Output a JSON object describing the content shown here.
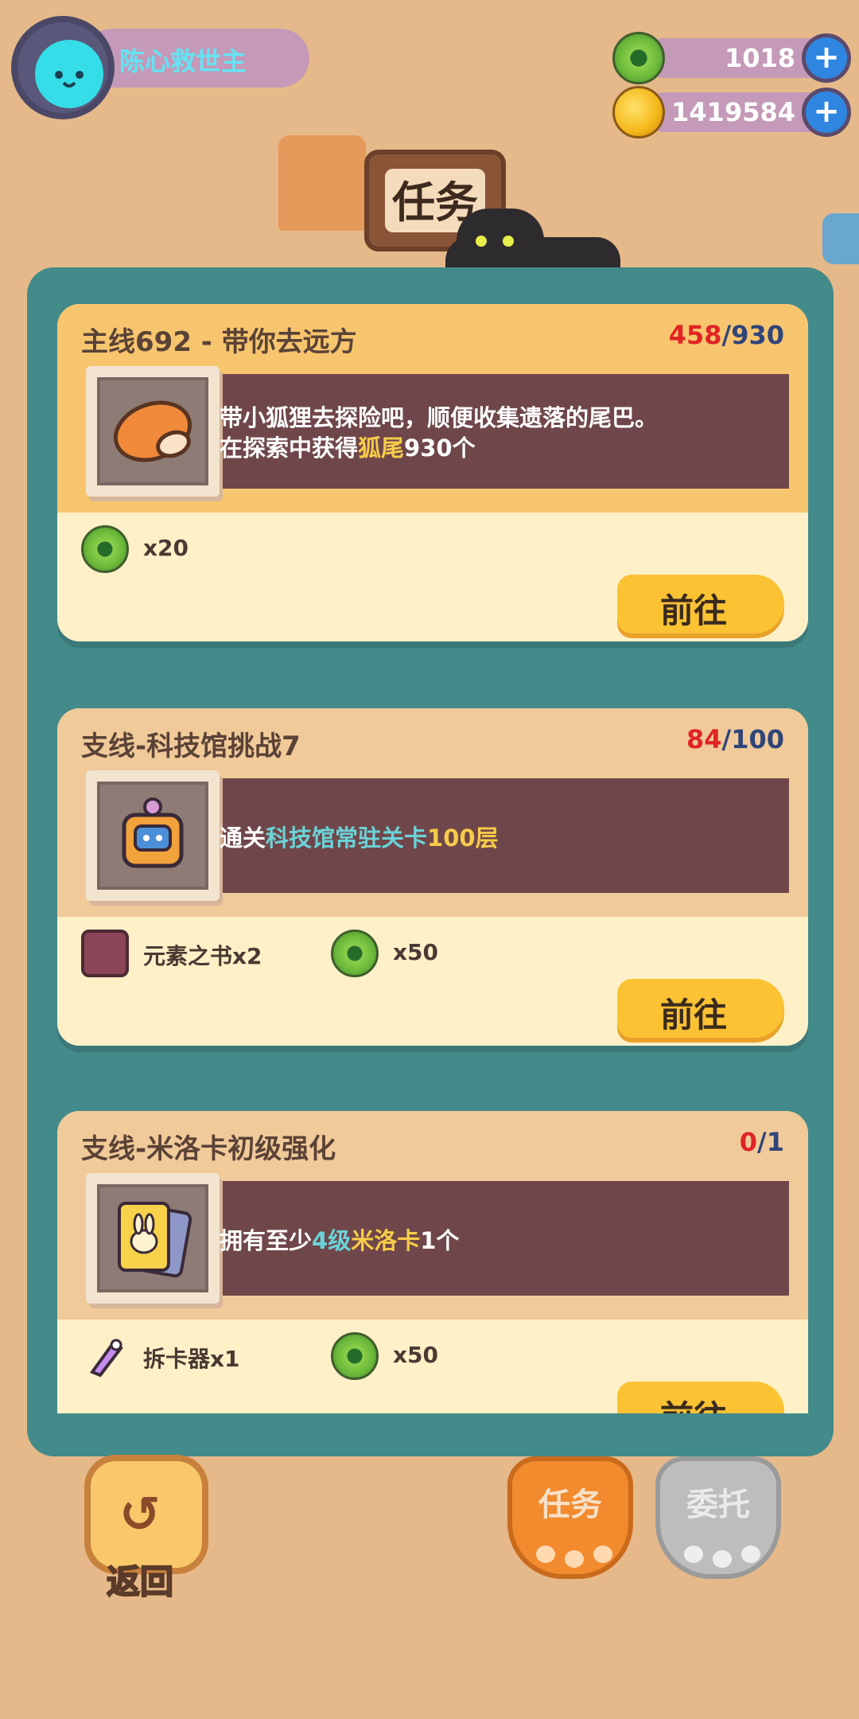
{
  "player": {
    "name": "陈心救世主",
    "avatar_icon": "cat-face-avatar"
  },
  "currency": [
    {
      "icon": "green-donut-coin",
      "value": "1018"
    },
    {
      "icon": "gold-planet-coin",
      "value": "1419584"
    }
  ],
  "header": {
    "title": "任务"
  },
  "tasks": [
    {
      "title": "主线692 - 带你去远方",
      "progress_current": "458",
      "progress_total": "930",
      "desc_line1": "带小狐狸去探险吧，顺便收集遗落的尾巴。",
      "desc_line2_prefix": "在探索中获得",
      "desc_line2_highlight": "狐尾",
      "desc_line2_suffix": "930个",
      "thumb_icon": "fox-tail-icon",
      "rewards": [
        {
          "icon": "green-donut-coin",
          "text": "x20"
        }
      ],
      "button": "前往"
    },
    {
      "title": "支线-科技馆挑战7",
      "progress_current": "84",
      "progress_total": "100",
      "desc_prefix": "通关",
      "desc_highlight_cyan": "科技馆常驻关卡",
      "desc_highlight_gold": "100层",
      "thumb_icon": "robot-backpack-icon",
      "rewards": [
        {
          "icon": "element-book-icon",
          "text": "元素之书x2"
        },
        {
          "icon": "green-donut-coin",
          "text": "x50"
        }
      ],
      "button": "前往"
    },
    {
      "title": "支线-米洛卡初级强化",
      "progress_current": "0",
      "progress_total": "1",
      "desc_prefix": "拥有至少",
      "desc_highlight_cyan": "4级",
      "desc_highlight_gold": "米洛卡",
      "desc_suffix": "1个",
      "thumb_icon": "bunny-card-icon",
      "rewards": [
        {
          "icon": "card-remover-tool-icon",
          "text": "拆卡器x1"
        },
        {
          "icon": "green-donut-coin",
          "text": "x50"
        }
      ],
      "button": "前往"
    }
  ],
  "bottom": {
    "back_label": "返回",
    "tab_tasks": "任务",
    "tab_commission": "委托"
  },
  "colors": {
    "background": "#e6b98a",
    "panel": "#438a8a",
    "main_card_top": "#f7c56e",
    "side_card_top": "#f1ca9a",
    "card_bottom": "#fff0c8",
    "desc_bar": "#6f474a",
    "progress_current": "#e02424",
    "progress_total": "#30457a",
    "button": "#fbc233"
  }
}
